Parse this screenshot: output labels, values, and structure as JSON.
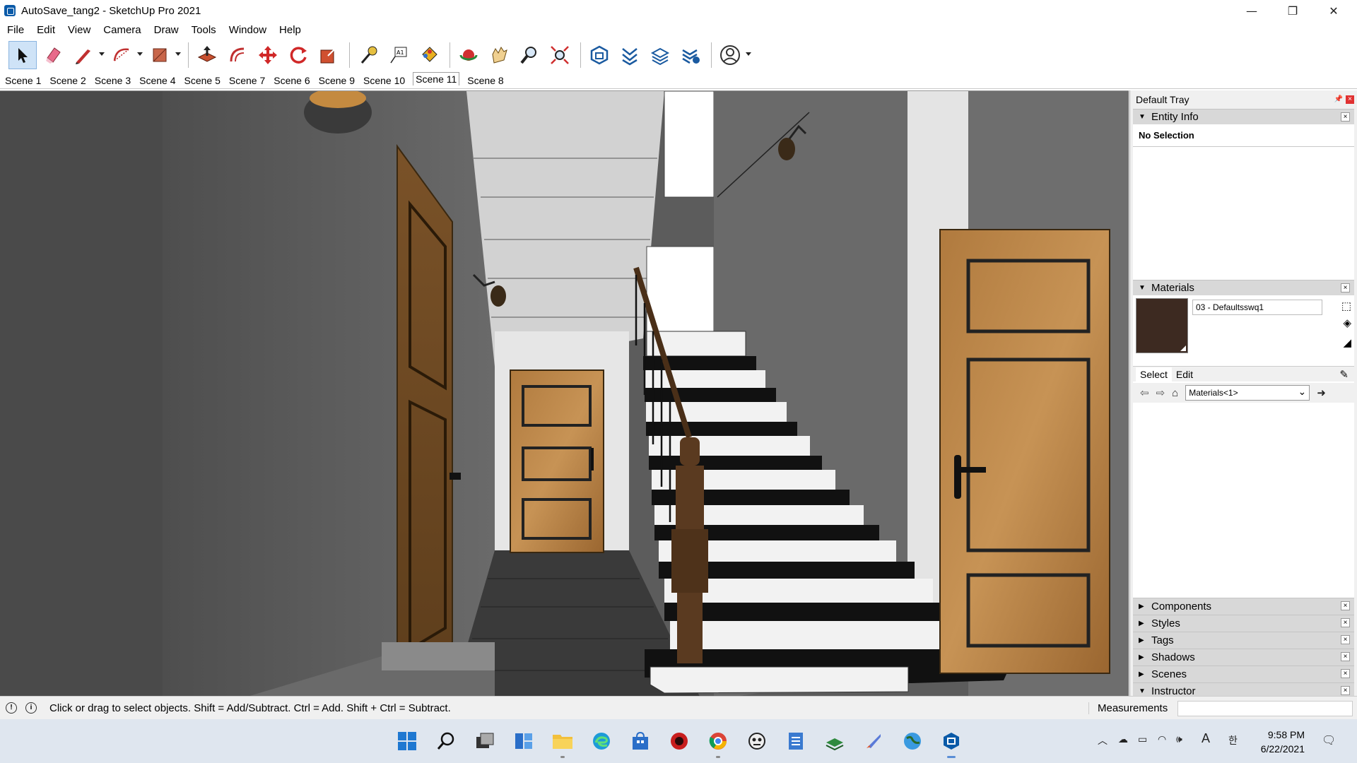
{
  "window": {
    "title": "AutoSave_tang2 - SketchUp Pro 2021",
    "minimize": "—",
    "restore": "❐",
    "close": "✕"
  },
  "menu": [
    "File",
    "Edit",
    "View",
    "Camera",
    "Draw",
    "Tools",
    "Window",
    "Help"
  ],
  "toolbar_icons": [
    "select-tool",
    "eraser-tool",
    "line-tool",
    "arc-tool",
    "rectangle-tool",
    "push-pull-tool",
    "offset-tool",
    "move-tool",
    "rotate-tool",
    "scale-tool",
    "tape-measure-tool",
    "text-tool",
    "paint-bucket-tool",
    "orbit-tool",
    "pan-tool",
    "zoom-tool",
    "zoom-extents-tool",
    "warehouse-tool",
    "extension-tool",
    "layout-tool",
    "extension-manager-tool",
    "account-tool"
  ],
  "scenes": {
    "tabs": [
      "Scene 1",
      "Scene 2",
      "Scene 3",
      "Scene 4",
      "Scene 5",
      "Scene 7",
      "Scene 6",
      "Scene 9",
      "Scene 10",
      "Scene 11",
      "Scene 8"
    ],
    "active": "Scene 11"
  },
  "tray": {
    "title": "Default Tray",
    "pin": "📌",
    "close": "×",
    "entity_info": {
      "label": "Entity Info",
      "selection": "No Selection"
    },
    "materials": {
      "label": "Materials",
      "current_name": "03 - Defaultsswq1",
      "swatch_color": "#3d2a21",
      "tab_select": "Select",
      "tab_edit": "Edit",
      "collection": "Materials<1>"
    },
    "collapsed_panels": [
      "Components",
      "Styles",
      "Tags",
      "Shadows",
      "Scenes"
    ],
    "expanded_bottom": "Instructor",
    "panel_close": "×"
  },
  "status": {
    "hint": "Click or drag to select objects. Shift = Add/Subtract. Ctrl = Add. Shift + Ctrl = Subtract.",
    "measurements_label": "Measurements",
    "measurements_value": ""
  },
  "taskbar": {
    "apps": [
      "windows-start-icon",
      "search-icon",
      "task-view-icon",
      "widgets-icon",
      "file-explorer-icon",
      "edge-icon",
      "store-icon",
      "app-red-icon",
      "chrome-icon",
      "app-robot-icon",
      "notepad-icon",
      "app-book-icon",
      "app-rocket-icon",
      "app-globe-icon",
      "sketchup-icon"
    ],
    "clock_time": "9:58 PM",
    "clock_date": "6/22/2021",
    "input_lang": "A",
    "ime": "한"
  },
  "colors": {
    "accent": "#0a5aa8",
    "tray_bg": "#f0f0f0",
    "taskbar_bg": "#dfe6ef"
  }
}
